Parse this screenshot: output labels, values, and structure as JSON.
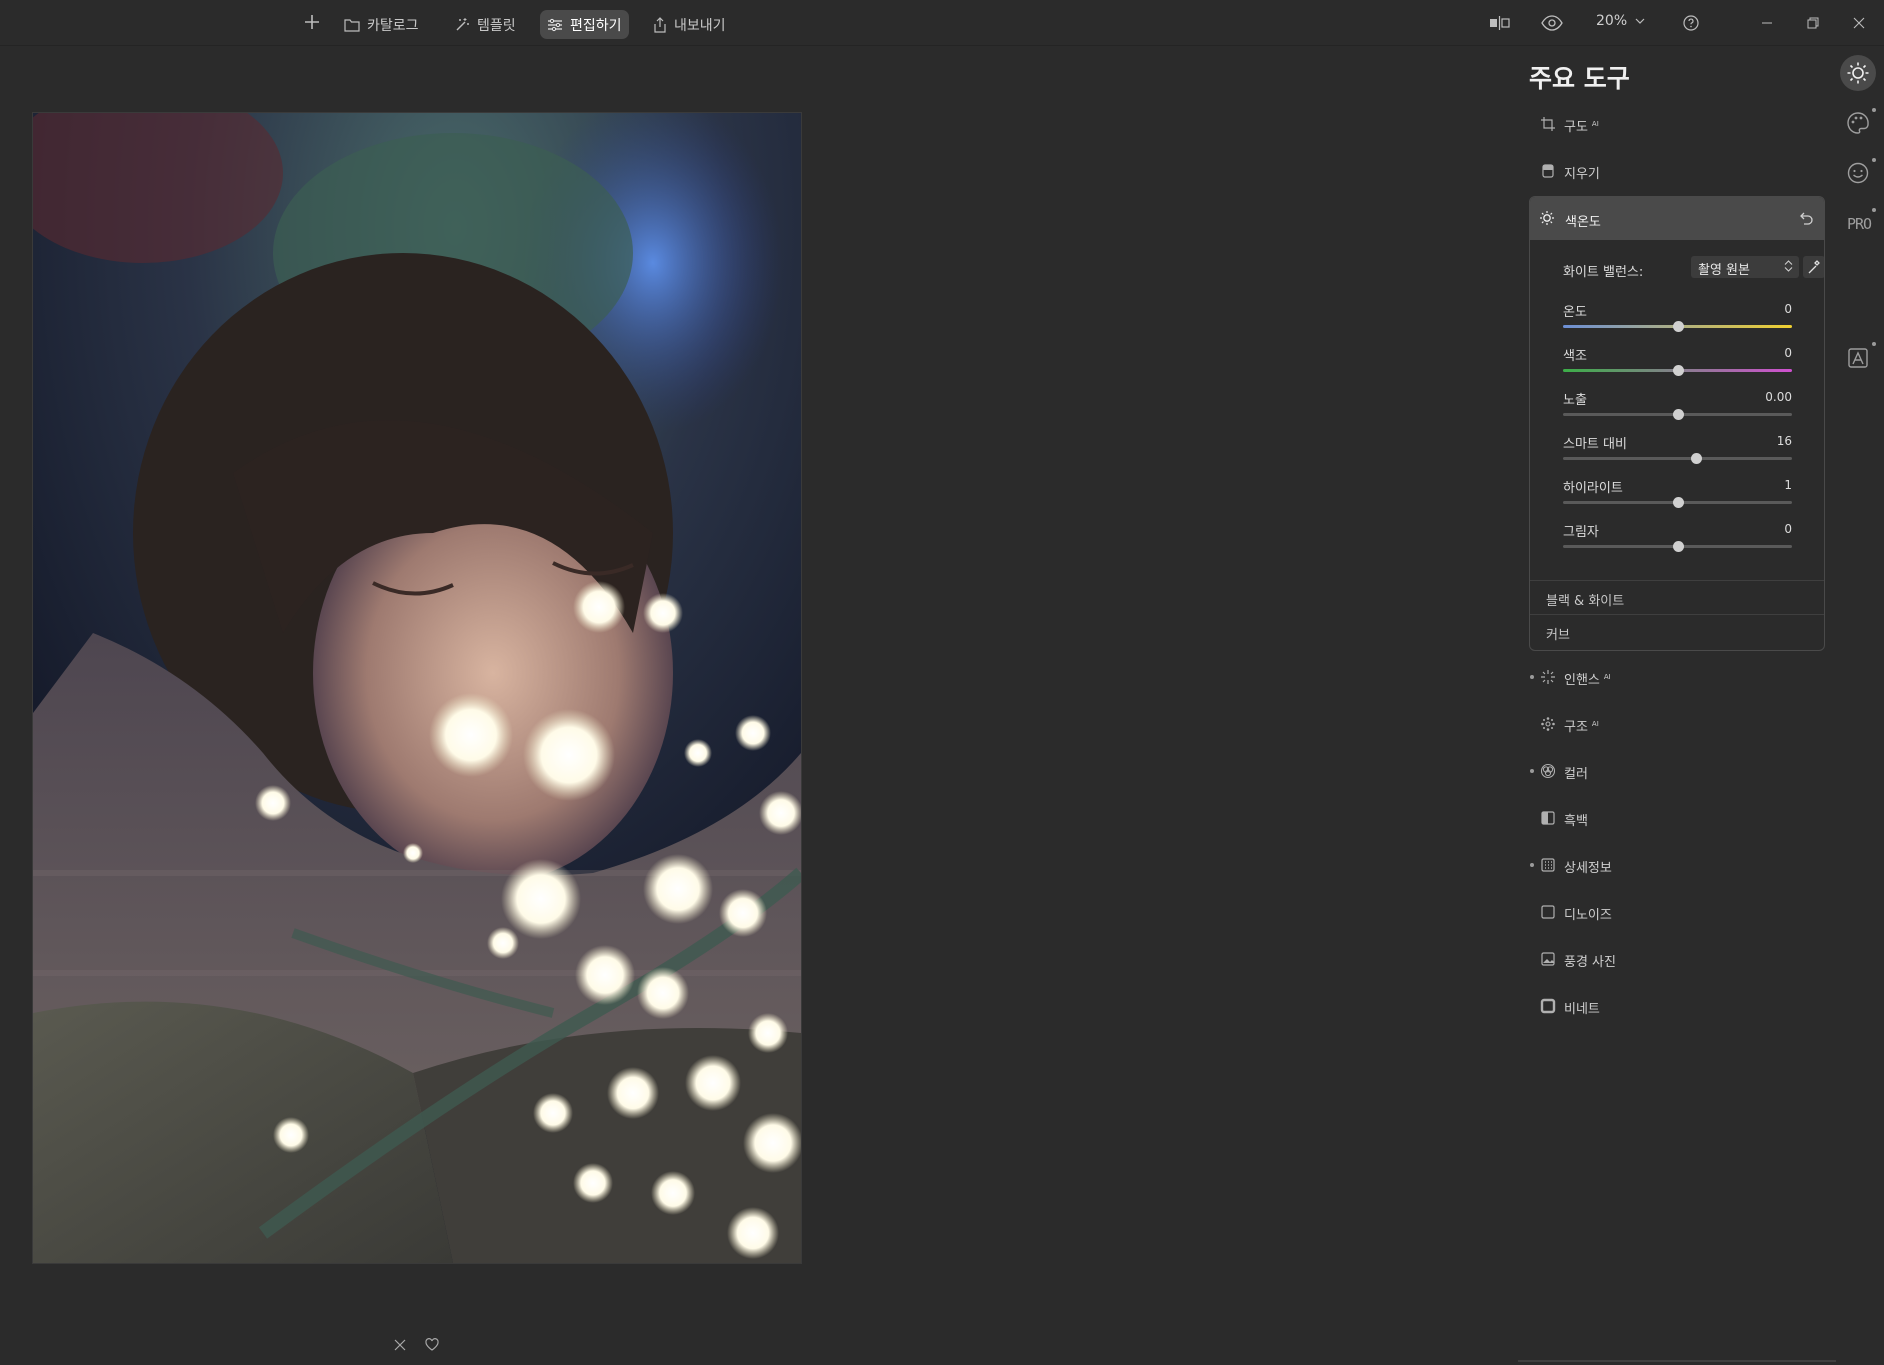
{
  "topbar": {
    "add_label": "",
    "catalog_label": "카탈로그",
    "templates_label": "템플릿",
    "edit_label": "편집하기",
    "export_label": "내보내기",
    "zoom_value": "20%"
  },
  "panel": {
    "title": "주요 도구",
    "tools_top": [
      {
        "label": "구도",
        "ai": "AI"
      },
      {
        "label": "지우기",
        "ai": ""
      }
    ],
    "white_balance": {
      "header": "색온도",
      "wb_label": "화이트 밸런스:",
      "wb_value": "촬영 원본",
      "sliders": [
        {
          "name": "온도",
          "value": "0",
          "pos": 0.5
        },
        {
          "name": "색조",
          "value": "0",
          "pos": 0.5
        },
        {
          "name": "노출",
          "value": "0.00",
          "pos": 0.5
        },
        {
          "name": "스마트 대비",
          "value": "16",
          "pos": 0.58
        },
        {
          "name": "하이라이트",
          "value": "1",
          "pos": 0.5
        },
        {
          "name": "그림자",
          "value": "0",
          "pos": 0.5
        }
      ],
      "sub_black_white": "블랙 & 화이트",
      "sub_curve": "커브"
    },
    "tools_bottom": [
      {
        "label": "인핸스",
        "ai": "AI"
      },
      {
        "label": "구조",
        "ai": "AI"
      },
      {
        "label": "컬러",
        "ai": ""
      },
      {
        "label": "흑백",
        "ai": ""
      },
      {
        "label": "상세정보",
        "ai": ""
      },
      {
        "label": "디노이즈",
        "ai": ""
      },
      {
        "label": "풍경 사진",
        "ai": ""
      },
      {
        "label": "비네트",
        "ai": ""
      }
    ]
  },
  "rail": {
    "pro_label": "PRO"
  },
  "colors": {
    "background": "#2b2b2b",
    "panel_header": "#4a4a4a",
    "temp_gradient": [
      "#6c8fd6",
      "#f0d030"
    ],
    "tint_gradient": [
      "#3cae48",
      "#d050d0"
    ]
  }
}
